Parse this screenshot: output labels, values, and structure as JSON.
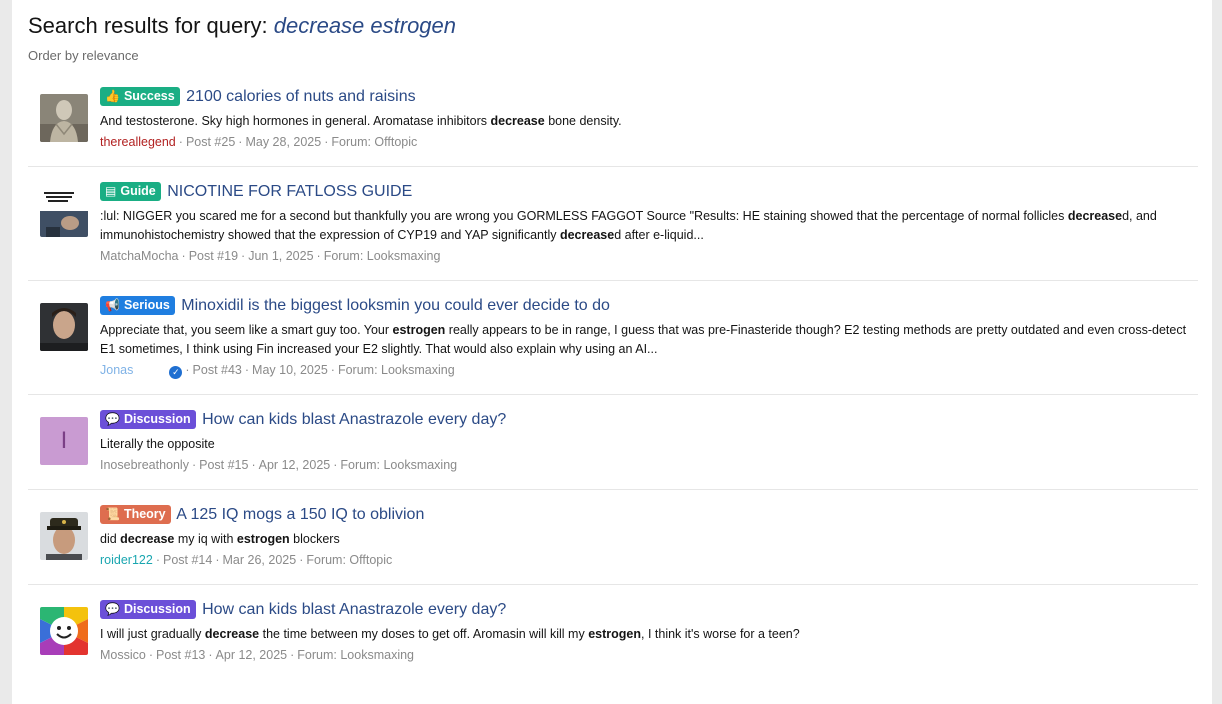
{
  "page": {
    "title_prefix": "Search results for query: ",
    "query": "decrease estrogen",
    "order": "Order by relevance"
  },
  "colors": {
    "success": "#1aae84",
    "guide": "#1aae84",
    "serious": "#1f7ee0",
    "discussion": "#6b4fd8",
    "theory": "#de6d4f",
    "link": "#2b4a86"
  },
  "results": [
    {
      "label": "Success",
      "label_icon": "thumbs-up-icon",
      "title": "2100 calories of nuts and raisins",
      "snippet": [
        {
          "t": "And testosterone. Sky high hormones in general. Aromatase inhibitors "
        },
        {
          "t": "decrease",
          "b": true
        },
        {
          "t": " bone density."
        }
      ],
      "user": "thereallegend",
      "user_color": "#b22222",
      "post": "Post #25",
      "date": "May 28, 2025",
      "forum": "Forum: Offtopic"
    },
    {
      "label": "Guide",
      "label_icon": "book-icon",
      "title": "NICOTINE FOR FATLOSS GUIDE",
      "snippet": [
        {
          "t": ":lul: NIGGER you scared me for a second but thankfully you are wrong you GORMLESS FAGGOT Source \"Results: HE staining showed that the percentage of normal follicles "
        },
        {
          "t": "decrease",
          "b": true
        },
        {
          "t": "d, and immunohistochemistry showed that the expression of CYP19 and YAP significantly "
        },
        {
          "t": "decrease",
          "b": true
        },
        {
          "t": "d after e-liquid..."
        }
      ],
      "user": "MatchaMocha",
      "user_color": "#8a8a8a",
      "post": "Post #19",
      "date": "Jun 1, 2025",
      "forum": "Forum: Looksmaxing"
    },
    {
      "label": "Serious",
      "label_icon": "megaphone-icon",
      "title": "Minoxidil is the biggest looksmin you could ever decide to do",
      "snippet": [
        {
          "t": "Appreciate that, you seem like a smart guy too. Your "
        },
        {
          "t": "estrogen",
          "b": true
        },
        {
          "t": " really appears to be in range, I guess that was pre-Finasteride though? E2 testing methods are pretty outdated and even cross-detect E1 sometimes, I think using Fin increased your E2 slightly. That would also explain why using an AI..."
        }
      ],
      "user": "Jonas",
      "user_color": "#7fb2e6",
      "verified": true,
      "post": "Post #43",
      "date": "May 10, 2025",
      "forum": "Forum: Looksmaxing"
    },
    {
      "label": "Discussion",
      "label_icon": "chat-bubbles-icon",
      "title": "How can kids blast Anastrazole every day?",
      "snippet": [
        {
          "t": "Literally the opposite"
        }
      ],
      "user": "Inosebreathonly",
      "user_color": "#8a8a8a",
      "avatar_letter": "I",
      "post": "Post #15",
      "date": "Apr 12, 2025",
      "forum": "Forum: Looksmaxing"
    },
    {
      "label": "Theory",
      "label_icon": "scroll-icon",
      "title": "A 125 IQ mogs a 150 IQ to oblivion",
      "snippet": [
        {
          "t": "did "
        },
        {
          "t": "decrease",
          "b": true
        },
        {
          "t": " my iq with "
        },
        {
          "t": "estrogen",
          "b": true
        },
        {
          "t": " blockers"
        }
      ],
      "user": "roider122",
      "user_color": "#1aa6b0",
      "post": "Post #14",
      "date": "Mar 26, 2025",
      "forum": "Forum: Offtopic"
    },
    {
      "label": "Discussion",
      "label_icon": "chat-bubbles-icon",
      "title": "How can kids blast Anastrazole every day?",
      "snippet": [
        {
          "t": "I will just gradually "
        },
        {
          "t": "decrease",
          "b": true
        },
        {
          "t": " the time between my doses to get off. Aromasin will kill my "
        },
        {
          "t": "estrogen",
          "b": true
        },
        {
          "t": ", I think it's worse for a teen?"
        }
      ],
      "user": "Mossico",
      "user_color": "#8a8a8a",
      "post": "Post #13",
      "date": "Apr 12, 2025",
      "forum": "Forum: Looksmaxing"
    }
  ]
}
